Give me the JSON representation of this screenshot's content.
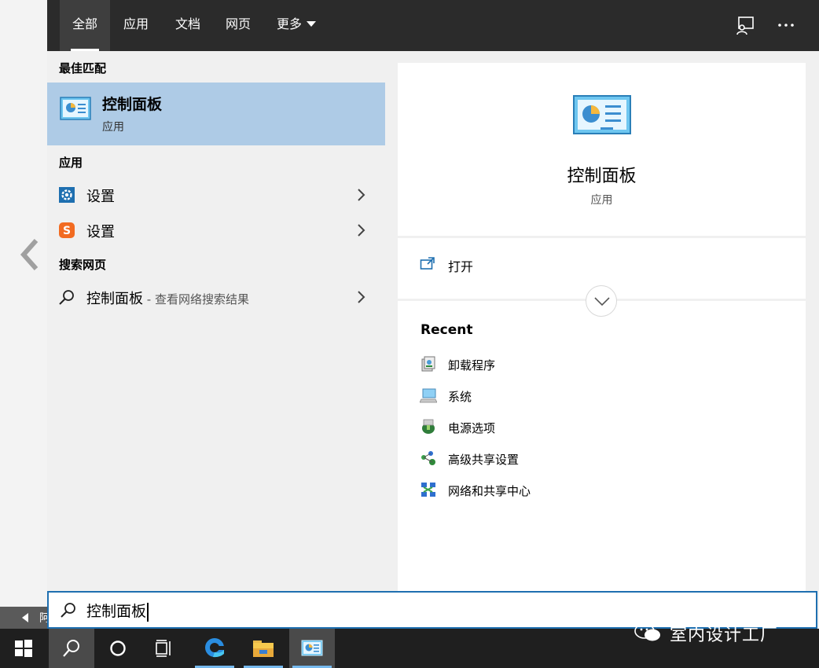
{
  "tabs": [
    {
      "label": "全部",
      "active": true
    },
    {
      "label": "应用"
    },
    {
      "label": "文档"
    },
    {
      "label": "网页"
    },
    {
      "label": "更多"
    }
  ],
  "top_icons": [
    "feedback-icon",
    "more-options-icon"
  ],
  "sections": {
    "best_match": "最佳匹配",
    "apps": "应用",
    "web": "搜索网页"
  },
  "best_match": {
    "title": "控制面板",
    "subtitle": "应用",
    "icon": "control-panel-icon"
  },
  "apps": [
    {
      "label": "设置",
      "icon": "gear-icon"
    },
    {
      "label": "设置",
      "icon": "sogou-settings-icon"
    }
  ],
  "web_result": {
    "label": "控制面板",
    "suffix": " - 查看网络搜索结果",
    "icon": "search-icon"
  },
  "detail": {
    "title": "控制面板",
    "subtitle": "应用",
    "open_label": "打开",
    "recent_heading": "Recent",
    "recent": [
      {
        "label": "卸载程序",
        "icon": "uninstall-program-icon"
      },
      {
        "label": "系统",
        "icon": "system-icon"
      },
      {
        "label": "电源选项",
        "icon": "power-options-icon"
      },
      {
        "label": "高级共享设置",
        "icon": "sharing-settings-icon"
      },
      {
        "label": "网络和共享中心",
        "icon": "network-center-icon"
      }
    ]
  },
  "search": {
    "value": "控制面板"
  },
  "taskbar": [
    {
      "name": "start-button",
      "icon": "windows-logo-icon"
    },
    {
      "name": "taskbar-search",
      "icon": "search-icon",
      "active": true
    },
    {
      "name": "cortana-button",
      "icon": "circle-icon"
    },
    {
      "name": "task-view-button",
      "icon": "task-view-icon"
    },
    {
      "name": "edge-app",
      "icon": "edge-icon",
      "running": true
    },
    {
      "name": "file-explorer-app",
      "icon": "folder-icon",
      "running": true
    },
    {
      "name": "control-panel-app",
      "icon": "control-panel-icon",
      "running": true
    }
  ],
  "watermark": {
    "text": "室内设计工厂"
  },
  "colors": {
    "topbar": "#2b2b2b",
    "selected": "#aecbe6",
    "accent": "#1e6fb0",
    "taskbar": "#1f1f1f"
  }
}
